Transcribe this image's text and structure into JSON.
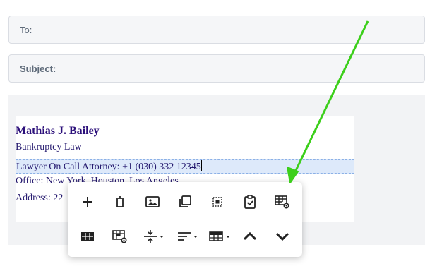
{
  "compose": {
    "to_label": "To:",
    "subject_label": "Subject:"
  },
  "signature": {
    "name": "Mathias J. Bailey",
    "title": "Bankruptcy Law",
    "line1": "Lawyer On Call Attorney: +1 (030) 332 12345",
    "line2": "Office: New York, Houston, Los Angeles",
    "line3": "Address: 22"
  },
  "toolbar": {
    "row1": [
      "add-icon",
      "delete-icon",
      "image-icon",
      "copy-icon",
      "select-icon",
      "paste-icon",
      "table-settings-icon"
    ],
    "row2": [
      "table-icon",
      "cell-settings-icon",
      "vertical-spacing-icon",
      "align-icon",
      "table-insert-icon",
      "chevron-up-icon",
      "chevron-down-icon"
    ]
  },
  "annotation": {
    "arrow_color": "#3ccf1b"
  }
}
